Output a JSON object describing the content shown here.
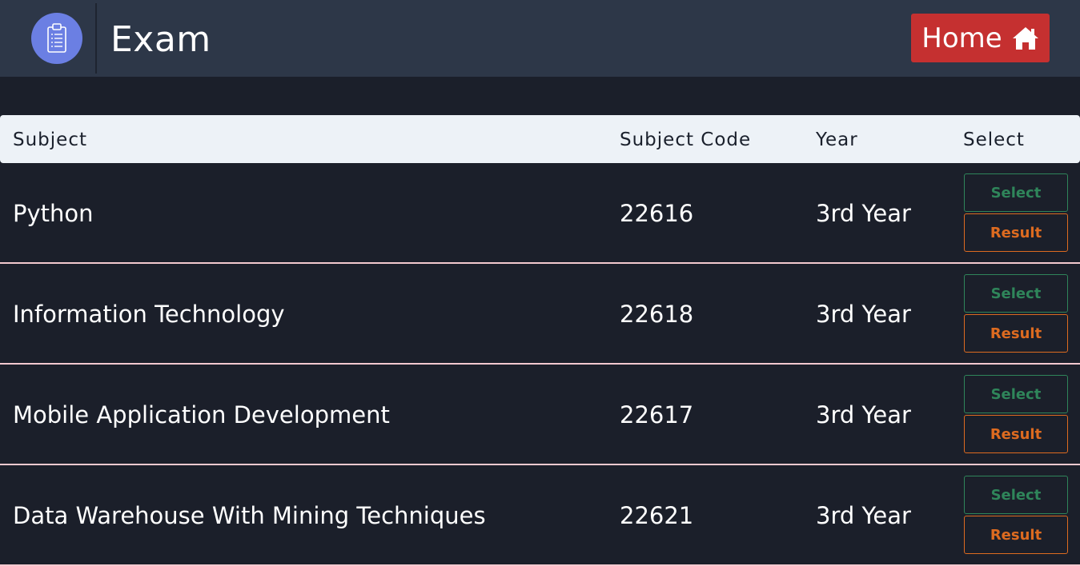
{
  "header": {
    "title": "Exam",
    "logo_icon": "clipboard-icon",
    "home_label": "Home",
    "home_icon": "home-icon",
    "colors": {
      "bar": "#2d3748",
      "logo": "#6b7fe3",
      "home_button": "#c53030"
    }
  },
  "table": {
    "columns": [
      "Subject",
      "Subject Code",
      "Year",
      "Select"
    ],
    "rows": [
      {
        "subject": "Python",
        "code": "22616",
        "year": "3rd Year",
        "select_label": "Select",
        "result_label": "Result"
      },
      {
        "subject": "Information Technology",
        "code": "22618",
        "year": "3rd Year",
        "select_label": "Select",
        "result_label": "Result"
      },
      {
        "subject": "Mobile Application Development",
        "code": "22617",
        "year": "3rd Year",
        "select_label": "Select",
        "result_label": "Result"
      },
      {
        "subject": "Data Warehouse With Mining Techniques",
        "code": "22621",
        "year": "3rd Year",
        "select_label": "Select",
        "result_label": "Result"
      }
    ],
    "colors": {
      "select": "#2f855a",
      "result": "#dd6b20",
      "row_divider": "#f3c9cf"
    }
  }
}
